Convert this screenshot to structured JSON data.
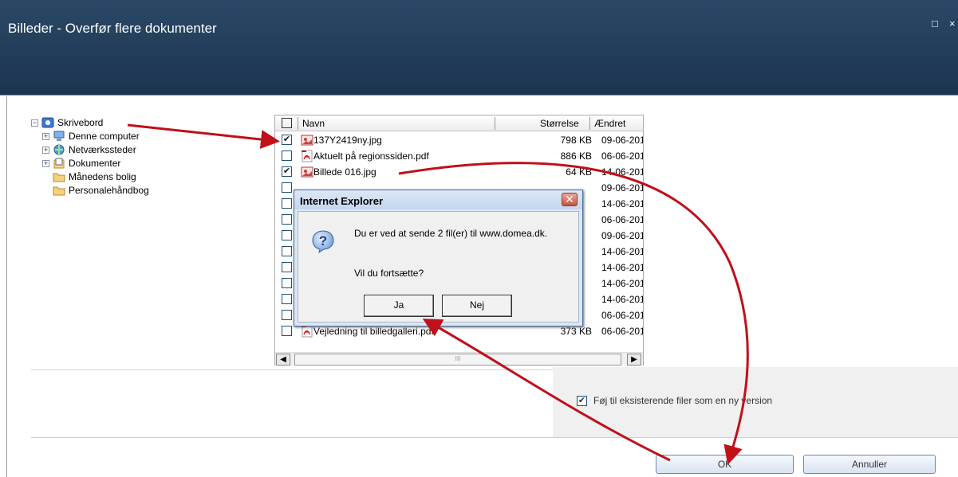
{
  "window": {
    "title": "Billeder - Overfør flere dokumenter",
    "restore_glyph": "□",
    "close_glyph": "×"
  },
  "tree": {
    "root": "Skrivebord",
    "items": [
      "Denne computer",
      "Netværkssteder",
      "Dokumenter",
      "Månedens bolig",
      "Personalehåndbog"
    ]
  },
  "filelist": {
    "headers": {
      "name": "Navn",
      "size": "Størrelse",
      "changed": "Ændret"
    },
    "rows": [
      {
        "checked": true,
        "name": "137Y2419ny.jpg",
        "type": "jpg",
        "size": "798 KB",
        "date": "09-06-201"
      },
      {
        "checked": false,
        "name": "Aktuelt på regionssiden.pdf",
        "type": "pdf",
        "size": "886 KB",
        "date": "06-06-201"
      },
      {
        "checked": true,
        "name": "Billede 016.jpg",
        "type": "jpg",
        "size": "64 KB",
        "date": "14-06-201"
      },
      {
        "checked": false,
        "name": "",
        "type": "",
        "size": "",
        "date": "09-06-201"
      },
      {
        "checked": false,
        "name": "",
        "type": "",
        "size": "",
        "date": "14-06-201"
      },
      {
        "checked": false,
        "name": "",
        "type": "",
        "size": "",
        "date": "06-06-201"
      },
      {
        "checked": false,
        "name": "",
        "type": "",
        "size": "",
        "date": "09-06-201"
      },
      {
        "checked": false,
        "name": "",
        "type": "",
        "size": "",
        "date": "14-06-201"
      },
      {
        "checked": false,
        "name": "",
        "type": "",
        "size": "",
        "date": "14-06-201"
      },
      {
        "checked": false,
        "name": "",
        "type": "",
        "size": "",
        "date": "14-06-201"
      },
      {
        "checked": false,
        "name": "",
        "type": "",
        "size": "",
        "date": "14-06-201"
      },
      {
        "checked": false,
        "name": "",
        "type": "",
        "size": "",
        "date": "06-06-201"
      },
      {
        "checked": false,
        "name": "Vejledning til billedgalleri.pdf",
        "type": "pdf",
        "size": "373 KB",
        "date": "06-06-201"
      }
    ],
    "scroll_thumb_glyph": "III"
  },
  "options": {
    "add_version_label": "Føj til eksisterende filer som en ny version",
    "add_version_checked": true
  },
  "buttons": {
    "ok": "OK",
    "cancel": "Annuller"
  },
  "dialog": {
    "title": "Internet Explorer",
    "message": "Du er ved at sende 2 fil(er) til www.domea.dk.",
    "question": "Vil du fortsætte?",
    "yes": "Ja",
    "no": "Nej",
    "close_glyph": "✕",
    "icon": "question-icon"
  },
  "colors": {
    "titlebar": "#1f3b58",
    "arrow": "#c0101a",
    "accent_border": "#6e88b5"
  }
}
